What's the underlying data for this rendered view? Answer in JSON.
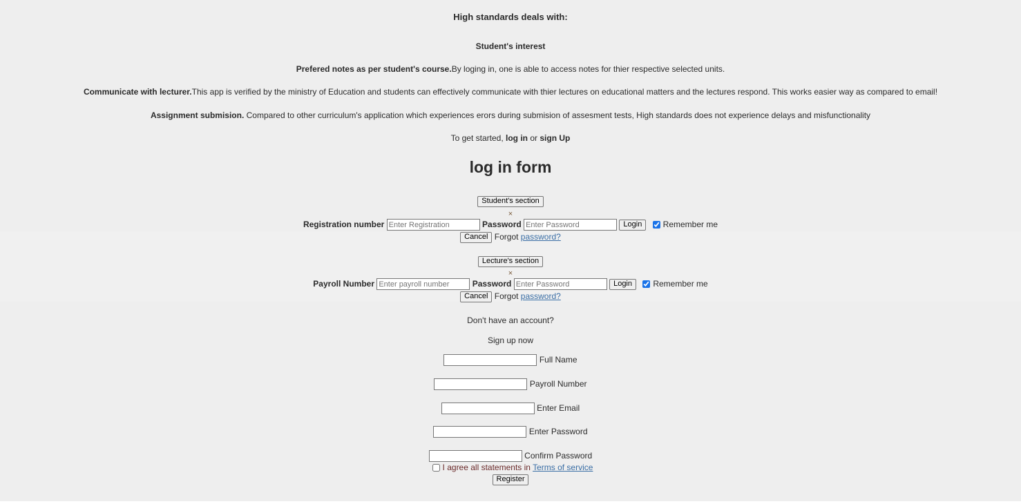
{
  "intro": {
    "heading": "High standards deals with:",
    "subheading": "Student's interest",
    "points": [
      {
        "title": "Prefered notes as per student's course.",
        "text": "By loging in, one is able to access notes for thier respective selected units."
      },
      {
        "title": "Communicate with lecturer.",
        "text": "This app is verified by the ministry of Education and students can effectively communicate with thier lectures on educational matters and the lectures respond. This works easier way as compared to email!"
      },
      {
        "title": "Assignment submision.",
        "text": " Compared to other curriculum's application which experiences erors during submision of assesment tests, High standards does not experience delays and misfunctionality"
      }
    ],
    "get_started_prefix": "To get started, ",
    "login_link": "log in",
    "or": " or ",
    "signup_link": "sign Up"
  },
  "login_form": {
    "title": "log in form",
    "student": {
      "section_button": "Student's section",
      "close": "×",
      "id_label": "Registration number",
      "id_placeholder": "Enter Registration",
      "password_label": "Password",
      "password_placeholder": "Enter Password",
      "login_button": "Login",
      "remember_label": "Remember me",
      "cancel_button": "Cancel",
      "forgot_text": "Forgot ",
      "forgot_link": "password?"
    },
    "lecturer": {
      "section_button": "Lecture's section",
      "close": "×",
      "id_label": "Payroll Number",
      "id_placeholder": "Enter payroll number",
      "password_label": "Password",
      "password_placeholder": "Enter Password",
      "login_button": "Login",
      "remember_label": "Remember me",
      "cancel_button": "Cancel",
      "forgot_text": "Forgot ",
      "forgot_link": "password?"
    }
  },
  "signup": {
    "no_account": "Don't have an account?",
    "signup_now": "Sign up now",
    "fields": {
      "full_name": "Full Name",
      "payroll": "Payroll Number",
      "email": "Enter Email",
      "password": "Enter Password",
      "confirm": "Confirm Password"
    },
    "agree_text": "I agree all statements in ",
    "terms_link": "Terms of service",
    "register_button": "Register"
  }
}
